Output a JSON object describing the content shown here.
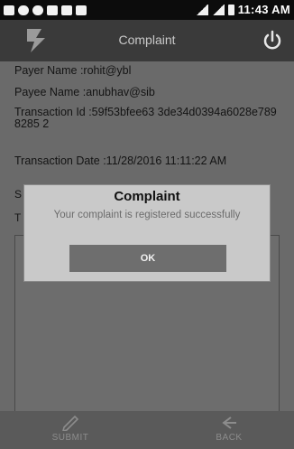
{
  "status_bar": {
    "time": "11:43 AM"
  },
  "app_bar": {
    "title": "Complaint"
  },
  "form": {
    "payer_name": "Payer Name :rohit@ybl",
    "payee_name": "Payee Name :anubhav@sib",
    "transaction_id": "Transaction Id :59f53bfee63 3de34d0394a6028e7898285 2",
    "transaction_date": "Transaction Date :11/28/2016 11:11:22 AM",
    "partial_label_1": "S",
    "partial_label_2": "T"
  },
  "dialog": {
    "title": "Complaint",
    "message": "Your complaint is registered successfully",
    "ok_label": "OK"
  },
  "bottom_nav": {
    "submit_label": "SUBMIT",
    "back_label": "BACK"
  },
  "icons": {
    "logo": "app-logo-icon",
    "power": "power-icon",
    "submit": "submit-icon",
    "back": "back-icon"
  }
}
